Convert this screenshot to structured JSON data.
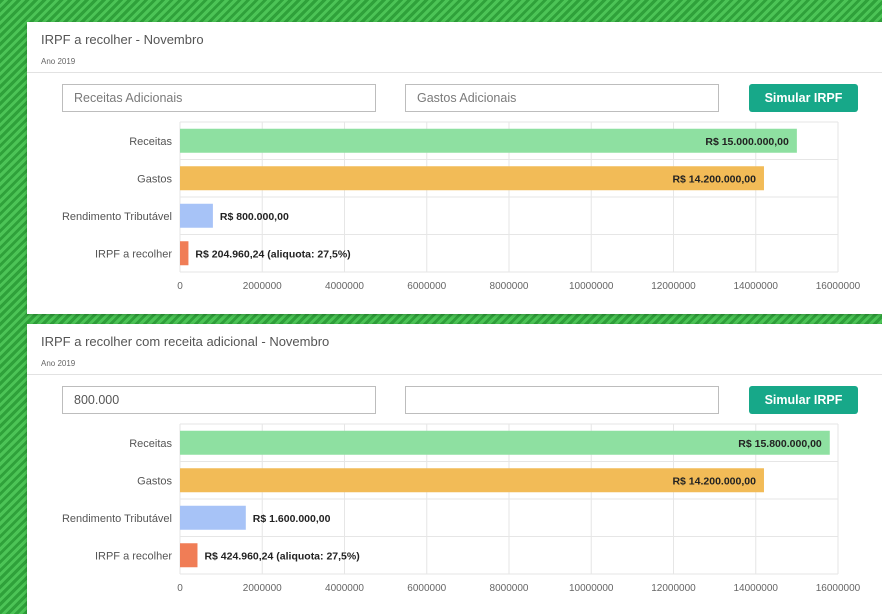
{
  "panels": [
    {
      "title": "IRPF a recolher - Novembro",
      "subtitle": "Ano 2019",
      "inputs": {
        "receitas_value": "",
        "receitas_placeholder": "Receitas Adicionais",
        "gastos_value": "",
        "gastos_placeholder": "Gastos Adicionais"
      },
      "button_label": "Simular IRPF"
    },
    {
      "title": "IRPF a recolher com receita adicional - Novembro",
      "subtitle": "Ano 2019",
      "inputs": {
        "receitas_value": "800.000",
        "receitas_placeholder": "",
        "gastos_value": "",
        "gastos_placeholder": ""
      },
      "button_label": "Simular IRPF"
    }
  ],
  "colors": {
    "accent": "#17a889",
    "receitas": "#8ee0a1",
    "gastos": "#f2bb57",
    "rendimento": "#a7c3f7",
    "irpf": "#f07d56",
    "background_stripe": "#3db548"
  },
  "chart_data": [
    {
      "type": "bar",
      "orientation": "horizontal",
      "categories": [
        "Receitas",
        "Gastos",
        "Rendimento Tributável",
        "IRPF a recolher"
      ],
      "values": [
        15000000,
        14200000,
        800000,
        204960.24
      ],
      "data_labels": [
        "R$ 15.000.000,00",
        "R$ 14.200.000,00",
        "R$ 800.000,00",
        "R$ 204.960,24 (aliquota: 27,5%)"
      ],
      "xlim": [
        0,
        16000000
      ],
      "xticks": [
        0,
        2000000,
        4000000,
        6000000,
        8000000,
        10000000,
        12000000,
        14000000,
        16000000
      ],
      "xtick_labels": [
        "0",
        "2000000",
        "4000000",
        "6000000",
        "8000000",
        "10000000",
        "12000000",
        "14000000",
        "16000000"
      ],
      "bar_colors": [
        "#8ee0a1",
        "#f2bb57",
        "#a7c3f7",
        "#f07d56"
      ],
      "grid": true
    },
    {
      "type": "bar",
      "orientation": "horizontal",
      "categories": [
        "Receitas",
        "Gastos",
        "Rendimento Tributável",
        "IRPF a recolher"
      ],
      "values": [
        15800000,
        14200000,
        1600000,
        424960.24
      ],
      "data_labels": [
        "R$ 15.800.000,00",
        "R$ 14.200.000,00",
        "R$ 1.600.000,00",
        "R$ 424.960,24 (aliquota: 27,5%)"
      ],
      "xlim": [
        0,
        16000000
      ],
      "xticks": [
        0,
        2000000,
        4000000,
        6000000,
        8000000,
        10000000,
        12000000,
        14000000,
        16000000
      ],
      "xtick_labels": [
        "0",
        "2000000",
        "4000000",
        "6000000",
        "8000000",
        "10000000",
        "12000000",
        "14000000",
        "16000000"
      ],
      "bar_colors": [
        "#8ee0a1",
        "#f2bb57",
        "#a7c3f7",
        "#f07d56"
      ],
      "grid": true
    }
  ]
}
